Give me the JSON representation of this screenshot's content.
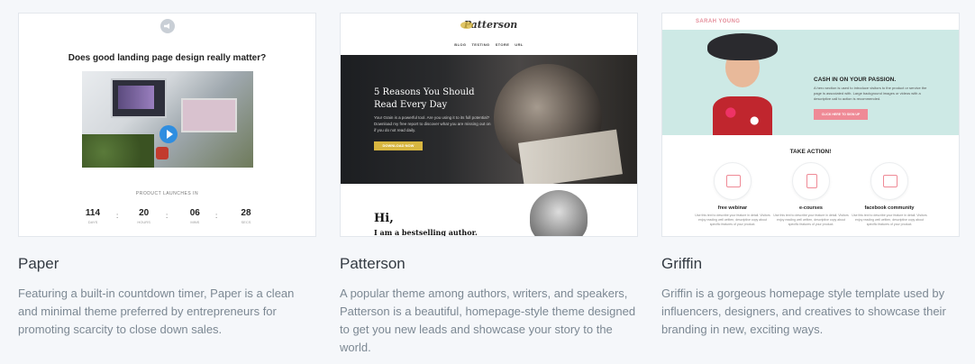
{
  "themes": [
    {
      "title": "Paper",
      "description": "Featuring a built-in countdown timer, Paper is a clean and minimal theme preferred by entrepreneurs for promoting scarcity to close down sales.",
      "preview": {
        "heading": "Does good landing page design really matter?",
        "launch_label": "PRODUCT LAUNCHES IN",
        "countdown": [
          {
            "value": "114",
            "unit": "DAYS"
          },
          {
            "value": "20",
            "unit": "HOURS"
          },
          {
            "value": "06",
            "unit": "MINS"
          },
          {
            "value": "28",
            "unit": "SECS"
          }
        ],
        "separator": ":"
      }
    },
    {
      "title": "Patterson",
      "description": "A popular theme among authors, writers, and speakers, Patterson is a beautiful, homepage-style theme designed to get you new leads and showcase your story to the world.",
      "preview": {
        "logo": "Patterson",
        "nav": [
          "BLOG",
          "TESTING",
          "STORE",
          "URL"
        ],
        "hero_title": "5 Reasons You Should Read Every Day",
        "hero_text": "Your Grain is a powerful tool. Are you using it to its full potential? Download my free report to discover what you are missing out on if you do not read daily.",
        "hero_button": "DOWNLOAD NOW",
        "intro_hi": "Hi,",
        "intro_line": "I am a bestselling author."
      }
    },
    {
      "title": "Griffin",
      "description": "Griffin is a gorgeous homepage style template used by influencers, designers, and creatives to showcase their branding in new, exciting ways.",
      "preview": {
        "logo_first": "SARAH",
        "logo_last": "YOUNG",
        "hero_title": "CASH IN ON YOUR PASSION.",
        "hero_text": "A hero section is used to introduce visitors to the product or service the page is associated with. Large background images or videos with a descriptive call to action is recommended.",
        "hero_button": "CLICK HERE TO SIGN UP",
        "section_title": "TAKE ACTION!",
        "features": [
          {
            "title": "free webinar",
            "text": "Use this text to describe your feature in detail. Visitors enjoy reading well written, descriptive copy about specific features of your product."
          },
          {
            "title": "e-courses",
            "text": "Use this text to describe your feature in detail. Visitors enjoy reading well written, descriptive copy about specific features of your product."
          },
          {
            "title": "facebook community",
            "text": "Use this text to describe your feature in detail. Visitors enjoy reading well written, descriptive copy about specific features of your product."
          }
        ]
      }
    }
  ]
}
